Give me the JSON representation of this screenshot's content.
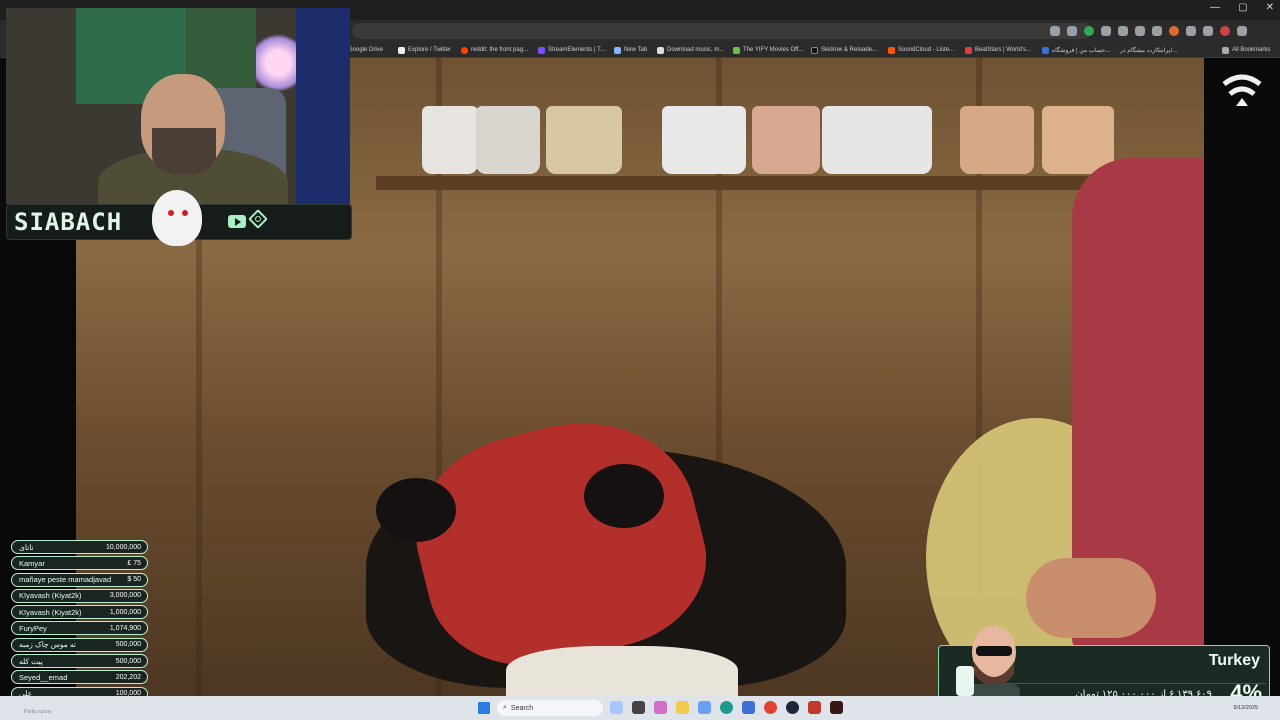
{
  "browser": {
    "window_controls": [
      "—",
      "▢",
      "✕"
    ],
    "bookmarks": [
      "Google Drive",
      "Explore / Twitter",
      "reddit: the front pag...",
      "StreamElements | T...",
      "New Tab",
      "Download music, m...",
      "The YIFY Movies Off...",
      "Skidrow & Reloade...",
      "SoundCloud - Liste...",
      "BeatStars | World's...",
      "حساب من | فروشگاه...",
      "اپرابتکارت بیشگام در...",
      "All Bookmarks"
    ]
  },
  "streamer": {
    "name": "SIABACH",
    "icons": [
      "youtube-icon",
      "kick-icon"
    ]
  },
  "donations": [
    {
      "name": "تاتای",
      "amount": "10,000,000"
    },
    {
      "name": "Kamyar",
      "amount": "£ 75"
    },
    {
      "name": "mañaye peste mamadjavad",
      "amount": "$ 50"
    },
    {
      "name": "Kīyavash (Kiyat2k)",
      "amount": "3,000,000"
    },
    {
      "name": "Kīyavash (Kiyat2k)",
      "amount": "1,000,000"
    },
    {
      "name": "FuryPey",
      "amount": "1,074,900"
    },
    {
      "name": "ته موس چاک زمبه",
      "amount": "500,000"
    },
    {
      "name": "پیت کله",
      "amount": "500,000"
    },
    {
      "name": "Seyed__emad",
      "amount": "202,202"
    },
    {
      "name": "علی",
      "amount": "100,000"
    }
  ],
  "goal_widget": {
    "title": "Turkey",
    "percent": "4%",
    "progress_text": "۶,۱۳۹,۶۰۹ از ۱۲۵,۰۰۰,۰۰۰ تومان",
    "progress_fraction": 0.04,
    "accent": "#7fdcae"
  },
  "taskbar": {
    "search_placeholder": "Search",
    "left_text": "Partly sunny",
    "date": "9/13/2025"
  },
  "colors": {
    "accent_mint": "#b8f0cf",
    "panel_dark": "#1a2420"
  }
}
